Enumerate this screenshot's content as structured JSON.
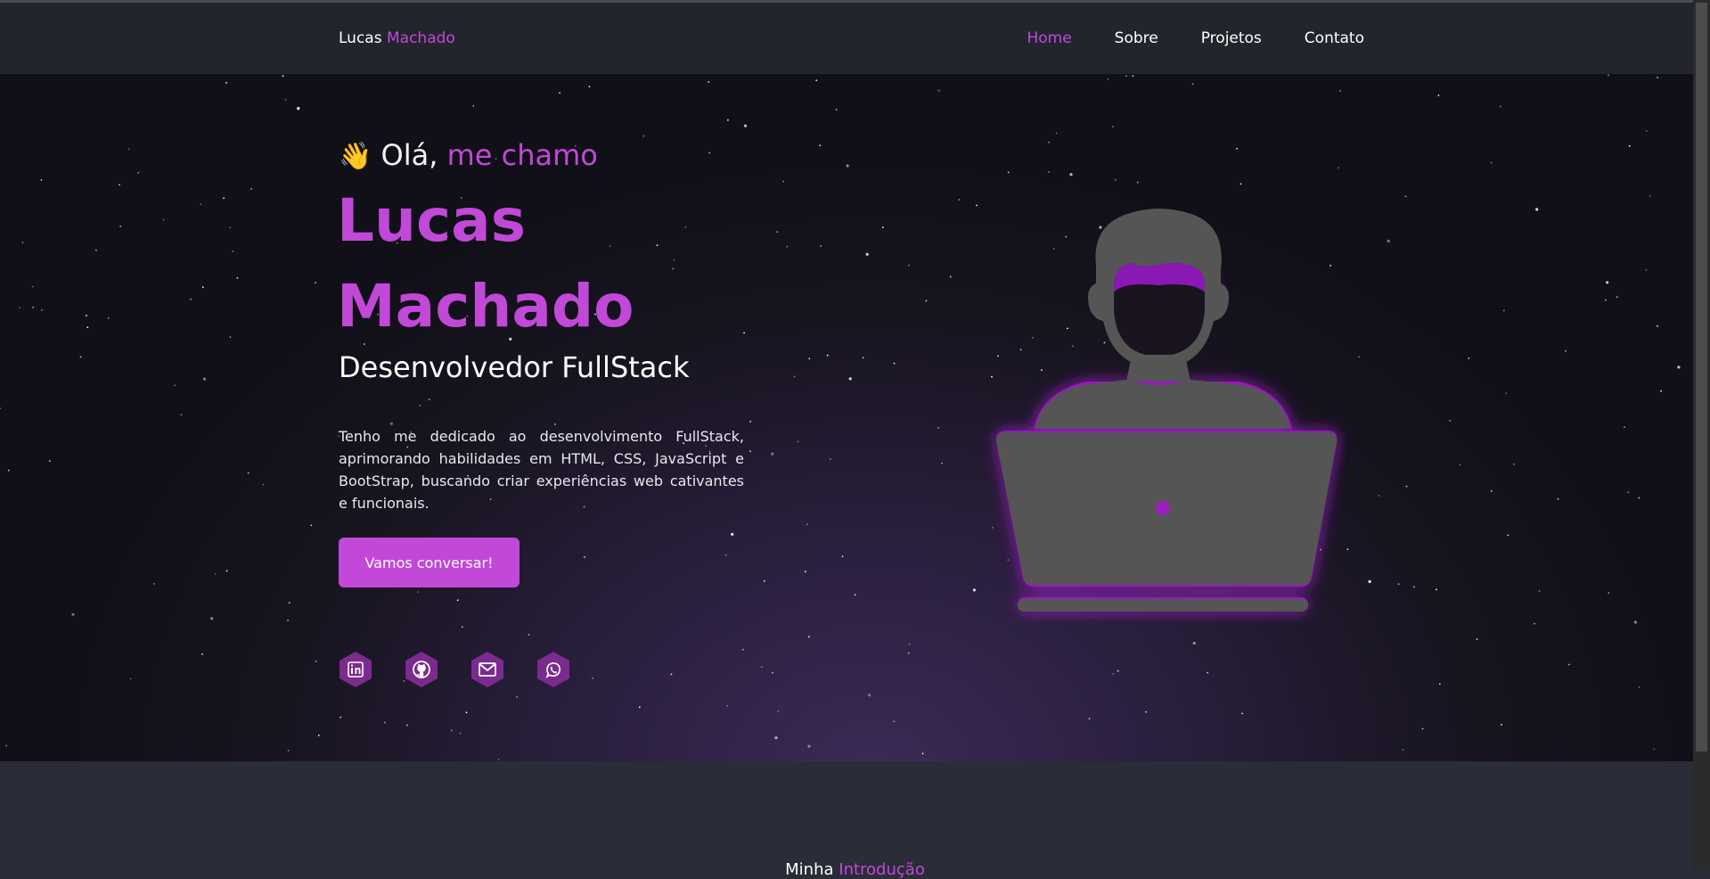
{
  "navbar": {
    "brand_first": "Lucas",
    "brand_second": "Machado",
    "links": [
      {
        "label": "Home",
        "active": true
      },
      {
        "label": "Sobre",
        "active": false
      },
      {
        "label": "Projetos",
        "active": false
      },
      {
        "label": "Contato",
        "active": false
      }
    ]
  },
  "hero": {
    "greeting_emoji": "👋",
    "greeting_text": "Olá,",
    "greeting_accent": "me chamo",
    "name_line_1": "Lucas",
    "name_line_2": "Machado",
    "role": "Desenvolvedor FullStack",
    "description": "Tenho me dedicado ao desenvolvimento FullStack, aprimorando habilidades em HTML, CSS, JavaScript e BootStrap, buscando criar experiências web cativantes e funcionais.",
    "cta_label": "Vamos conversar!",
    "socials": [
      {
        "icon": "linkedin-icon"
      },
      {
        "icon": "github-icon"
      },
      {
        "icon": "mail-icon"
      },
      {
        "icon": "whatsapp-icon"
      }
    ],
    "illustration_icon": "developer-laptop-icon"
  },
  "next_section": {
    "title_first": "Minha",
    "title_accent": "Introdução"
  },
  "colors": {
    "accent": "#c248d8",
    "navbar_bg": "#23252d",
    "section_bg": "#2a2c38",
    "social_hex": "#7b2a8e",
    "illustration_gray": "#555555",
    "glow": "#9b1fc2"
  }
}
